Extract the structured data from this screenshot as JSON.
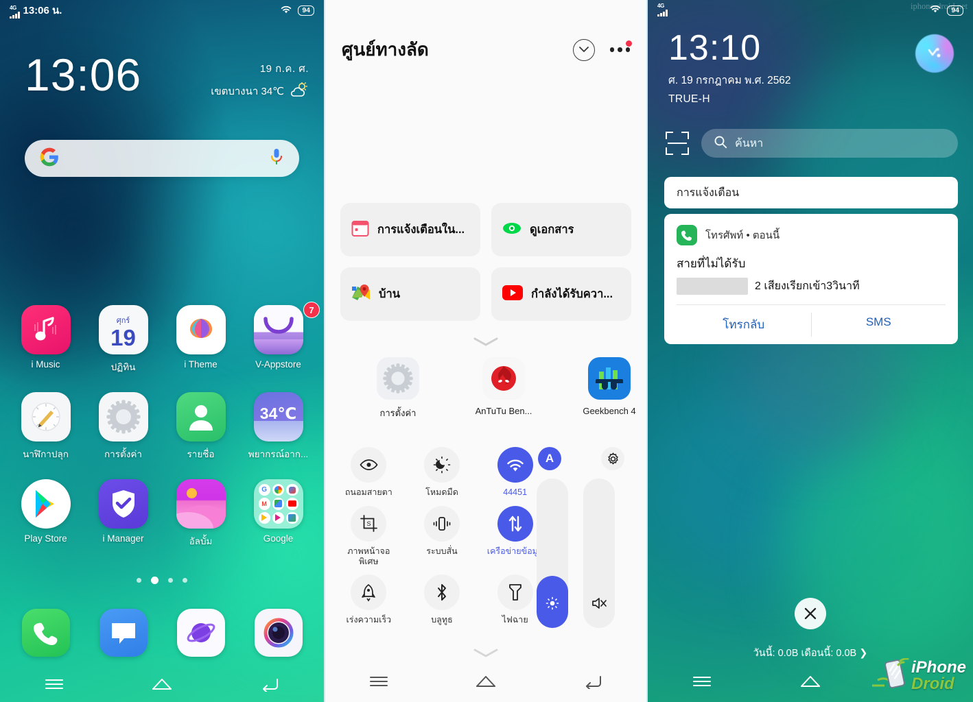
{
  "panel1": {
    "status": {
      "network": "4G",
      "time": "13:06 น.",
      "battery": "94",
      "wifi_icon": "wifi-icon"
    },
    "lock": {
      "clock": "13:06",
      "date": "19 ก.ค.  ศ.",
      "weather": "เขตบางนา 34℃",
      "weather_icon": "partly-cloudy-icon"
    },
    "search": {
      "google_icon": "google-g-icon",
      "mic_icon": "microphone-icon"
    },
    "apps": [
      {
        "label": "i Music",
        "icon": "imusic-icon",
        "badge": ""
      },
      {
        "label": "ปฏิทิน",
        "icon": "calendar-icon",
        "day": "19",
        "weekday": "ศุกร์",
        "badge": ""
      },
      {
        "label": "i Theme",
        "icon": "itheme-icon",
        "badge": ""
      },
      {
        "label": "V-Appstore",
        "icon": "vappstore-icon",
        "badge": "7"
      },
      {
        "label": "นาฬิกาปลุก",
        "icon": "alarm-clock-icon",
        "badge": ""
      },
      {
        "label": "การตั้งค่า",
        "icon": "settings-gear-icon",
        "badge": ""
      },
      {
        "label": "รายชื่อ",
        "icon": "contacts-icon",
        "badge": ""
      },
      {
        "label": "พยากรณ์อาก...",
        "icon": "weather-icon",
        "temp": "34℃",
        "badge": ""
      },
      {
        "label": "Play Store",
        "icon": "play-store-icon",
        "badge": ""
      },
      {
        "label": "i Manager",
        "icon": "imanager-shield-icon",
        "badge": ""
      },
      {
        "label": "อัลบั้ม",
        "icon": "album-gallery-icon",
        "badge": ""
      },
      {
        "label": "Google",
        "icon": "google-folder-icon",
        "badge": ""
      }
    ],
    "dock": [
      {
        "label": "",
        "icon": "phone-dialer-icon"
      },
      {
        "label": "",
        "icon": "messages-icon"
      },
      {
        "label": "",
        "icon": "browser-planet-icon"
      },
      {
        "label": "",
        "icon": "camera-icon"
      }
    ],
    "page_dots": {
      "count": 4,
      "active_index": 1
    },
    "navbar": {
      "recents": "menu-icon",
      "home": "home-icon",
      "back": "back-icon"
    }
  },
  "panel2": {
    "title": "ศูนย์ทางลัด",
    "collapse_icon": "chevron-down-circle-icon",
    "more_icon": "more-dots-icon",
    "more_has_badge": true,
    "cards": [
      {
        "label": "การแจ้งเตือนใน...",
        "icon": "calendar-red-icon"
      },
      {
        "label": "ดูเอกสาร",
        "icon": "eye-green-icon"
      },
      {
        "label": "บ้าน",
        "icon": "google-maps-icon"
      },
      {
        "label": "กำลังได้รับควา...",
        "icon": "youtube-icon"
      }
    ],
    "expand_icon": "chevron-down-icon",
    "apps": [
      {
        "label": "การตั้งค่า",
        "icon": "settings-gear-icon"
      },
      {
        "label": "AnTuTu Ben...",
        "icon": "antutu-icon"
      },
      {
        "label": "Geekbench 4",
        "icon": "geekbench-icon"
      }
    ],
    "toggles": [
      {
        "label": "ถนอมสายตา",
        "icon": "eye-care-icon",
        "active": false
      },
      {
        "label": "โหมดมืด",
        "icon": "dark-mode-icon",
        "active": false
      },
      {
        "label": "44451",
        "icon": "wifi-icon",
        "active": true
      },
      {
        "label": "ภาพหน้าจอพิเศษ",
        "icon": "screenshot-icon",
        "active": false
      },
      {
        "label": "ระบบสั่น",
        "icon": "vibrate-icon",
        "active": false
      },
      {
        "label": "เครือข่ายข้อมูล",
        "icon": "mobile-data-icon",
        "active": true
      },
      {
        "label": "เร่งความเร็ว",
        "icon": "rocket-boost-icon",
        "active": false
      },
      {
        "label": "บลูทูธ",
        "icon": "bluetooth-icon",
        "active": false
      },
      {
        "label": "ไฟฉาย",
        "icon": "flashlight-icon",
        "active": false
      }
    ],
    "sliders": {
      "auto_brightness_label": "A",
      "auto_brightness_icon": "auto-brightness-icon",
      "settings_icon": "gear-icon",
      "brightness": {
        "icon": "brightness-sun-icon",
        "percent": 35
      },
      "volume": {
        "icon": "volume-mute-icon",
        "percent": 0
      }
    },
    "navbar": {
      "recents": "menu-icon",
      "home": "home-icon",
      "back": "back-icon"
    }
  },
  "panel3": {
    "status": {
      "network": "4G",
      "battery": "94",
      "wifi_icon": "wifi-icon"
    },
    "clock": "13:10",
    "date": "ศ. 19 กรกฎาคม พ.ศ. 2562",
    "carrier": "TRUE-H",
    "jovi_icon": "jovi-assistant-icon",
    "scan_icon": "scan-code-icon",
    "search_placeholder": "ค้นหา",
    "search_icon": "search-icon",
    "notifications_header": "การแจ้งเตือน",
    "notification": {
      "app_icon": "phone-missed-call-icon",
      "app_name": "โทรศัพท์ • ตอนนี้",
      "title": "สายที่ไม่ได้รับ",
      "redacted": true,
      "detail": "2  เสียงเรียกเข้า3วินาที",
      "action_call": "โทรกลับ",
      "action_sms": "SMS"
    },
    "close_icon": "close-x-icon",
    "data_usage": "วันนี้: 0.0B เดือนนี้: 0.0B ❯",
    "navbar": {
      "recents": "menu-icon",
      "home": "home-icon",
      "back": "back-icon"
    },
    "watermark_top": "iphone-droid.net",
    "watermark_logo_line1": "iPhone",
    "watermark_logo_line2": "Droid"
  },
  "colors": {
    "accent_blue": "#4a5ae8",
    "badge_red": "#f4314a",
    "notif_link": "#2060b8",
    "green": "#25b458"
  }
}
